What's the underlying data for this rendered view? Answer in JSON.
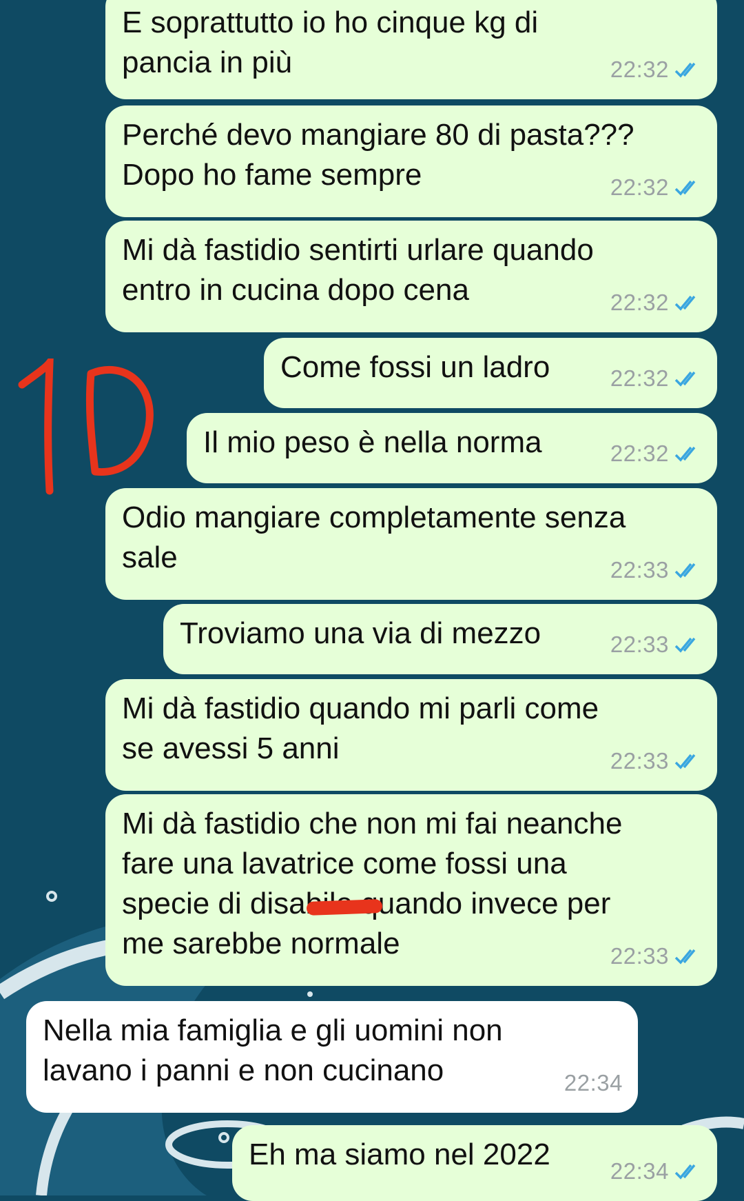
{
  "chat": {
    "messages": [
      {
        "id": 1,
        "direction": "outgoing",
        "text": "E soprattutto io ho cinque kg di\npancia in più",
        "time": "22:32",
        "status": "read"
      },
      {
        "id": 2,
        "direction": "outgoing",
        "text": "Perché devo mangiare 80 di pasta???\nDopo ho fame sempre",
        "time": "22:32",
        "status": "read"
      },
      {
        "id": 3,
        "direction": "outgoing",
        "text": "Mi dà fastidio sentirti urlare quando\nentro in cucina dopo cena",
        "time": "22:32",
        "status": "read"
      },
      {
        "id": 4,
        "direction": "outgoing",
        "text": "Come fossi un ladro",
        "time": "22:32",
        "status": "read"
      },
      {
        "id": 5,
        "direction": "outgoing",
        "text": "Il mio peso è nella norma",
        "time": "22:32",
        "status": "read"
      },
      {
        "id": 6,
        "direction": "outgoing",
        "text": "Odio mangiare completamente senza\nsale",
        "time": "22:33",
        "status": "read"
      },
      {
        "id": 7,
        "direction": "outgoing",
        "text": "Troviamo una via di mezzo",
        "time": "22:33",
        "status": "read"
      },
      {
        "id": 8,
        "direction": "outgoing",
        "text": "Mi dà fastidio quando mi parli come\nse avessi 5 anni",
        "time": "22:33",
        "status": "read"
      },
      {
        "id": 9,
        "direction": "outgoing",
        "text": "Mi dà fastidio che non mi fai neanche\nfare una lavatrice come fossi una\nspecie di disabile quando invece per\nme sarebbe normale",
        "time": "22:33",
        "status": "read"
      },
      {
        "id": 10,
        "direction": "incoming",
        "text": "Nella mia famiglia e gli uomini non\nlavano i panni e non cucinano",
        "time": "22:34"
      },
      {
        "id": 11,
        "direction": "outgoing",
        "text": "Eh ma siamo nel 2022",
        "time": "22:34",
        "status": "read"
      }
    ]
  },
  "annotation": {
    "text": "10",
    "color": "#e8341c"
  },
  "colors": {
    "background": "#0f4a63",
    "outgoing_bubble": "#e6ffd8",
    "incoming_bubble": "#ffffff",
    "read_ticks": "#3aa6e0",
    "timestamp": "#9aa0a3"
  },
  "icons": {
    "read_receipt": "double-check-icon"
  }
}
